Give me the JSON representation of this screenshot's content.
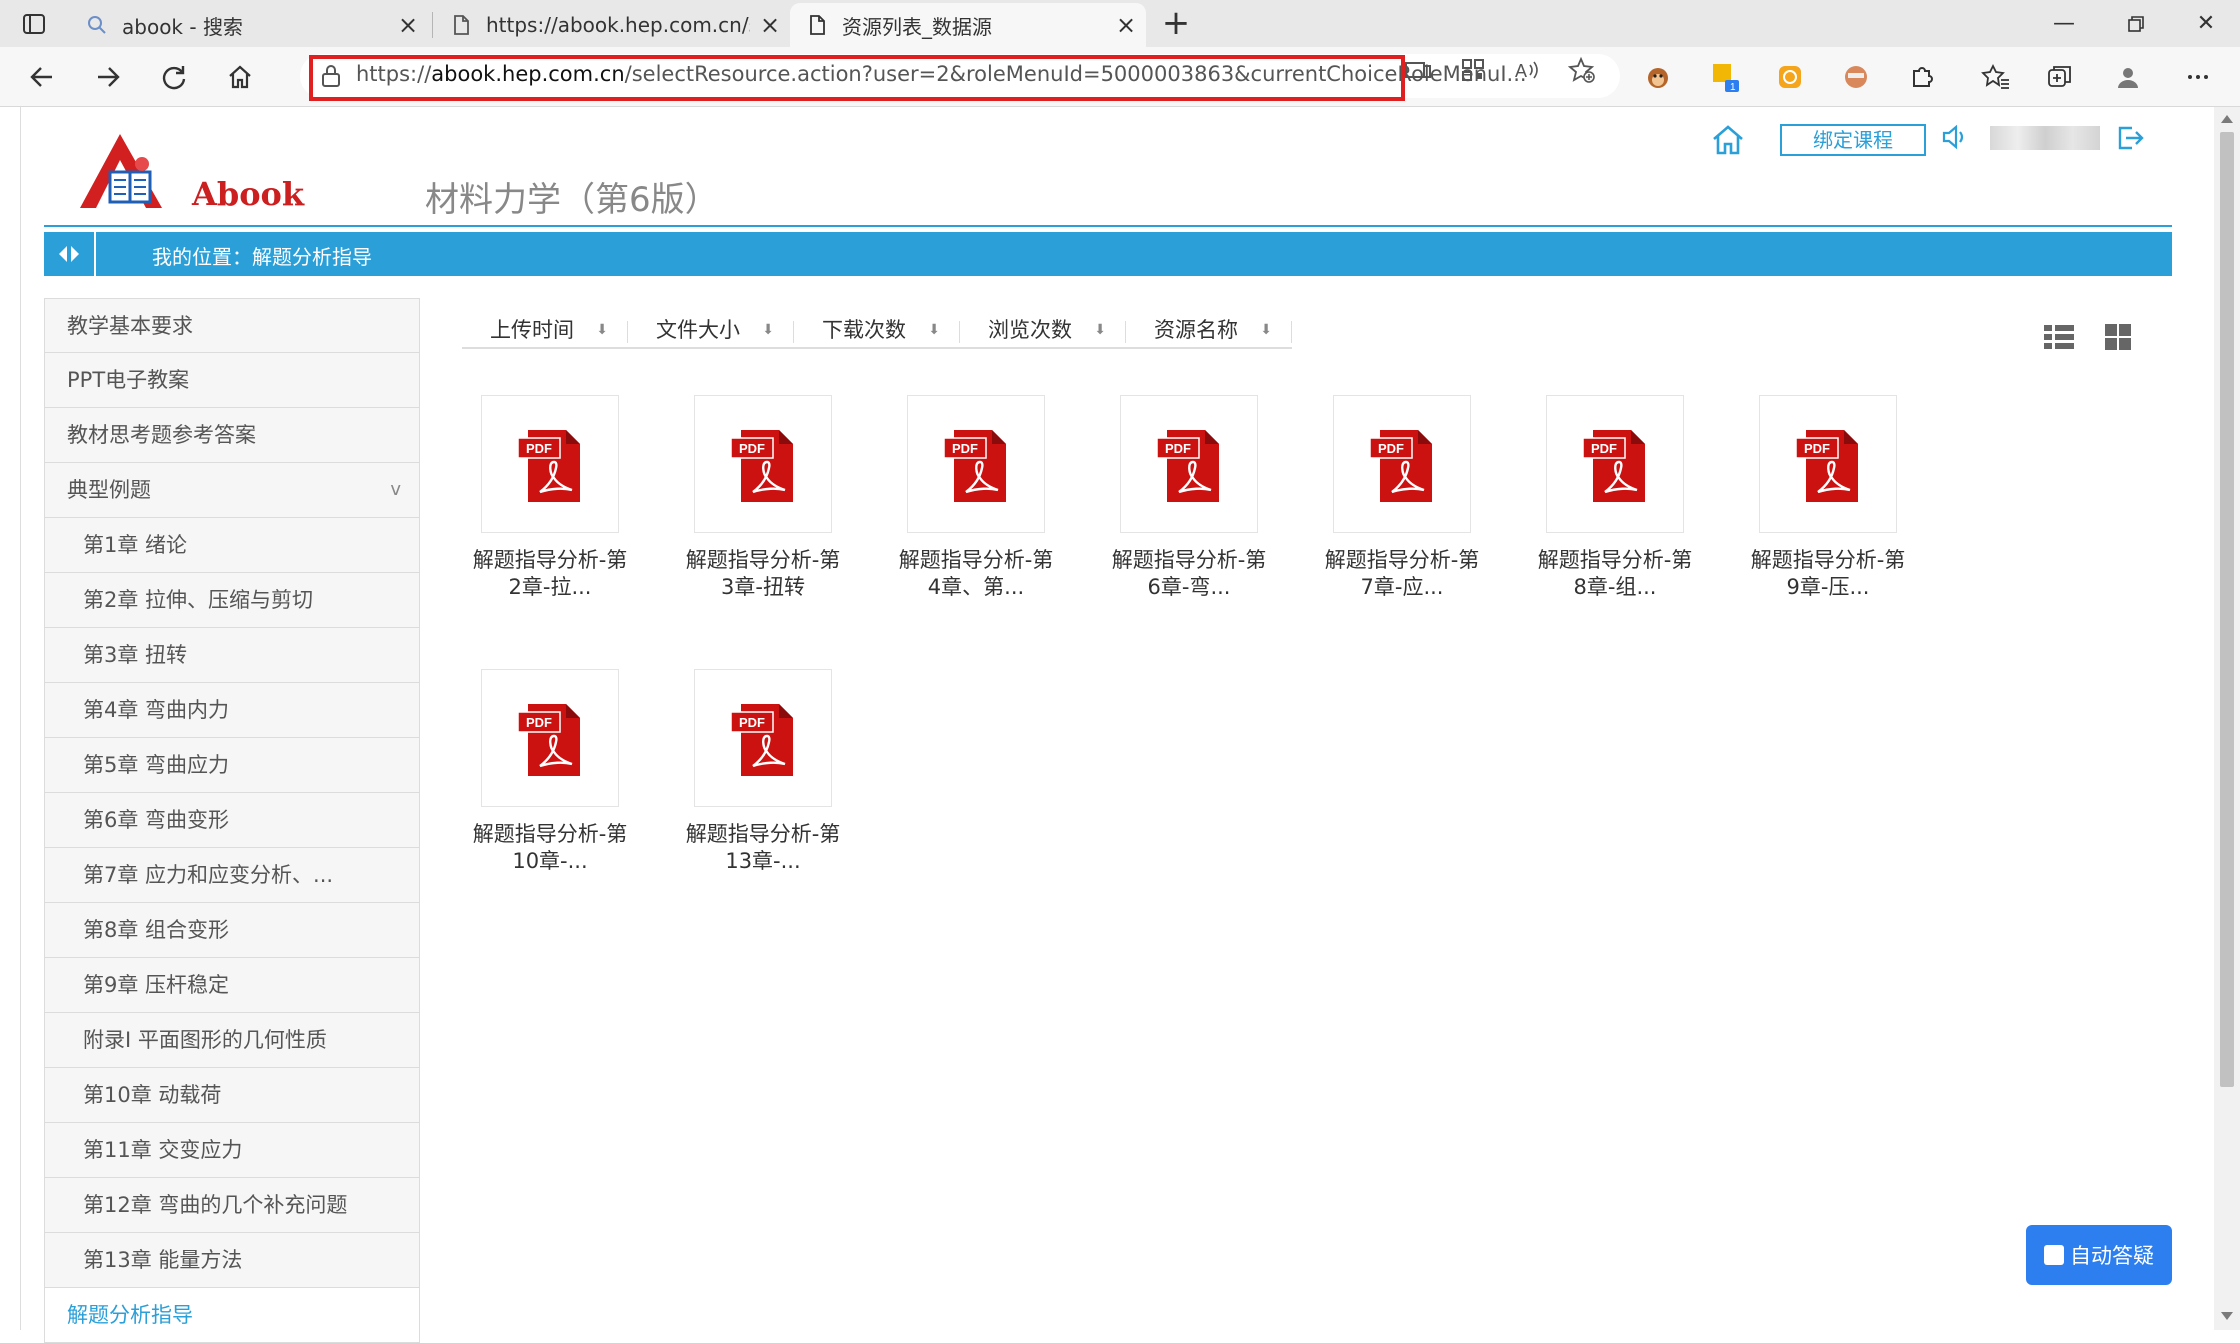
{
  "browser": {
    "tabs": [
      {
        "title": "abook - 搜索",
        "icon": "search-icon"
      },
      {
        "title": "https://abook.hep.com.cn/selectR",
        "icon": "page-icon"
      },
      {
        "title": "资源列表_数据源",
        "icon": "page-icon",
        "active": true
      }
    ],
    "url_prefix": "https://",
    "url_host": "abook.hep.com.cn",
    "url_rest": "/selectResource.action?user=2&roleMenuId=5000003863&currentChoiceRoleMenuI...",
    "annotation": "url"
  },
  "header": {
    "logo_text": "Abook",
    "book_title": "材料力学（第6版）",
    "bind_course": "绑定课程"
  },
  "breadcrumb": "我的位置：解题分析指导",
  "sidebar": [
    {
      "label": "教学基本要求",
      "sub": false
    },
    {
      "label": "PPT电子教案",
      "sub": false
    },
    {
      "label": "教材思考题参考答案",
      "sub": false
    },
    {
      "label": "典型例题",
      "sub": false,
      "expand": "v"
    },
    {
      "label": "第1章 绪论",
      "sub": true
    },
    {
      "label": "第2章 拉伸、压缩与剪切",
      "sub": true
    },
    {
      "label": "第3章 扭转",
      "sub": true
    },
    {
      "label": "第4章 弯曲内力",
      "sub": true
    },
    {
      "label": "第5章 弯曲应力",
      "sub": true
    },
    {
      "label": "第6章 弯曲变形",
      "sub": true
    },
    {
      "label": "第7章 应力和应变分析、...",
      "sub": true
    },
    {
      "label": "第8章 组合变形",
      "sub": true
    },
    {
      "label": "第9章 压杆稳定",
      "sub": true
    },
    {
      "label": "附录Ⅰ 平面图形的几何性质",
      "sub": true
    },
    {
      "label": "第10章 动载荷",
      "sub": true
    },
    {
      "label": "第11章 交变应力",
      "sub": true
    },
    {
      "label": "第12章 弯曲的几个补充问题",
      "sub": true
    },
    {
      "label": "第13章 能量方法",
      "sub": true
    },
    {
      "label": "解题分析指导",
      "sub": false,
      "active": true
    }
  ],
  "sort": {
    "labels": [
      "上传时间",
      "文件大小",
      "下载次数",
      "浏览次数",
      "资源名称"
    ],
    "arrow": "⬇"
  },
  "pdf_badge": "PDF",
  "resources": [
    {
      "line1": "解题指导分析-第",
      "line2": "2章-拉..."
    },
    {
      "line1": "解题指导分析-第",
      "line2": "3章-扭转"
    },
    {
      "line1": "解题指导分析-第",
      "line2": "4章、第..."
    },
    {
      "line1": "解题指导分析-第",
      "line2": "6章-弯..."
    },
    {
      "line1": "解题指导分析-第",
      "line2": "7章-应..."
    },
    {
      "line1": "解题指导分析-第",
      "line2": "8章-组..."
    },
    {
      "line1": "解题指导分析-第",
      "line2": "9章-压..."
    },
    {
      "line1": "解题指导分析-第",
      "line2": "10章-..."
    },
    {
      "line1": "解题指导分析-第",
      "line2": "13章-..."
    }
  ],
  "assist_button": "自动答疑",
  "colors": {
    "accent": "#2a9fd8",
    "pdf_red": "#cc1111",
    "highlight": "#e02020",
    "button_blue": "#2d7ff0"
  }
}
